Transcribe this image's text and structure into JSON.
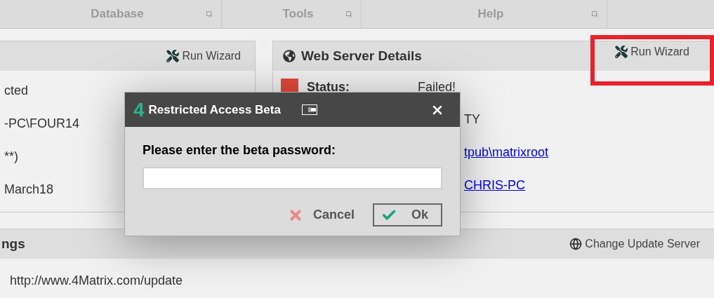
{
  "tabs": [
    {
      "label": "Database"
    },
    {
      "label": "Tools"
    },
    {
      "label": "Help"
    }
  ],
  "left_panel": {
    "button": "Run Wizard",
    "rows": [
      "cted",
      "-PC\\FOUR14",
      "**)",
      "March18"
    ]
  },
  "web_server_panel": {
    "title": "Web Server Details",
    "button": "Run Wizard",
    "annotated": true,
    "status": {
      "color": "#e04a3a",
      "label": "Status:",
      "value": "Failed!"
    },
    "rows": [
      {
        "kind": "text",
        "text": "TY"
      },
      {
        "kind": "link",
        "text": "tpub\\matrixroot"
      },
      {
        "kind": "link",
        "text": "CHRIS-PC"
      }
    ]
  },
  "update_panel": {
    "title": "ngs",
    "button": "Change Update Server",
    "url": "http://www.4Matrix.com/update"
  },
  "dialog": {
    "logo": "4",
    "title": "Restricted Access Beta",
    "prompt": "Please enter the beta password:",
    "buttons": [
      {
        "kind": "cancel",
        "label": "Cancel"
      },
      {
        "kind": "ok",
        "label": "Ok"
      }
    ]
  }
}
